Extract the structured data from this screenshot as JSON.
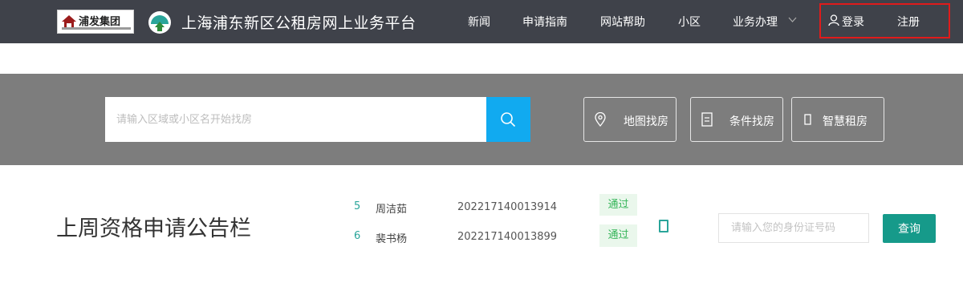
{
  "header": {
    "logo_text": "浦发集团",
    "site_title": "上海浦东新区公租房网上业务平台",
    "nav": [
      {
        "label": "新闻"
      },
      {
        "label": "申请指南"
      },
      {
        "label": "网站帮助"
      },
      {
        "label": "小区"
      },
      {
        "label": "业务办理"
      }
    ],
    "login_label": "登录",
    "register_label": "注册"
  },
  "search": {
    "placeholder": "请输入区域或小区名开始找房",
    "buttons": [
      {
        "label": "地图找房",
        "icon": "map-pin-icon"
      },
      {
        "label": "条件找房",
        "icon": "document-icon"
      },
      {
        "label": "智慧租房",
        "icon": "smart-icon"
      }
    ]
  },
  "board": {
    "title": "上周资格申请公告栏",
    "rows": [
      {
        "num": "5",
        "name": "周洁茹",
        "id": "202217140013914",
        "status": "通过"
      },
      {
        "num": "6",
        "name": "裴书杨",
        "id": "202217140013899",
        "status": "通过"
      }
    ],
    "id_placeholder": "请输入您的身份证号码",
    "query_label": "查询"
  },
  "colors": {
    "header_bg": "#3f424a",
    "search_band": "#7d7d7d",
    "search_button": "#11aaf0",
    "teal": "#169a8a",
    "status_green": "#35b559",
    "highlight": "#e01b1b"
  }
}
